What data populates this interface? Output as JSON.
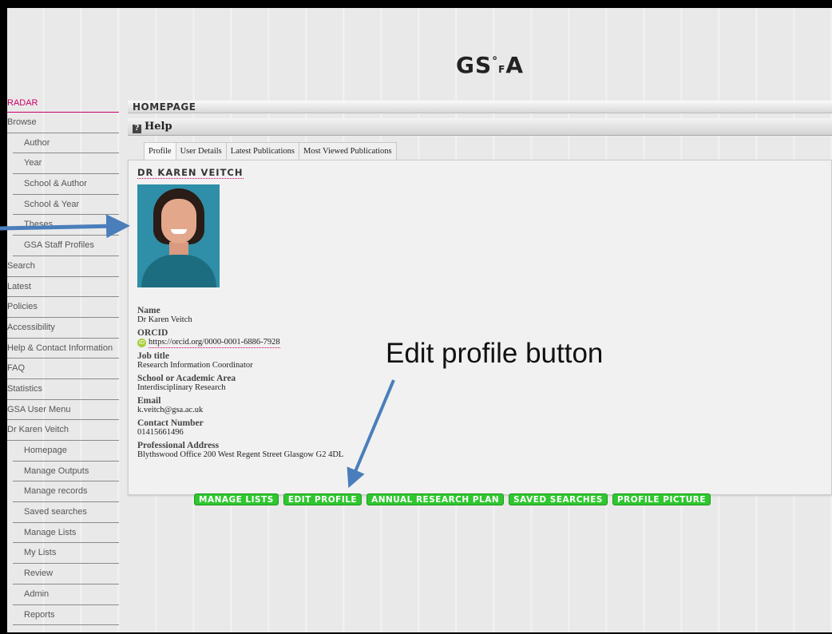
{
  "header": {
    "logo_text": "GSᵒⁱA"
  },
  "sidebar": {
    "items": [
      {
        "label": "RADAR",
        "kind": "radar"
      },
      {
        "label": "Browse",
        "kind": "top"
      },
      {
        "label": "Author",
        "kind": "sub"
      },
      {
        "label": "Year",
        "kind": "sub"
      },
      {
        "label": "School & Author",
        "kind": "sub"
      },
      {
        "label": "School & Year",
        "kind": "sub"
      },
      {
        "label": "Theses",
        "kind": "sub"
      },
      {
        "label": "GSA Staff Profiles",
        "kind": "sub"
      },
      {
        "label": "Search",
        "kind": "top"
      },
      {
        "label": "Latest",
        "kind": "top"
      },
      {
        "label": "Policies",
        "kind": "top"
      },
      {
        "label": "Accessibility",
        "kind": "top"
      },
      {
        "label": "Help & Contact Information",
        "kind": "top"
      },
      {
        "label": "FAQ",
        "kind": "top"
      },
      {
        "label": "Statistics",
        "kind": "top"
      },
      {
        "label": "GSA User Menu",
        "kind": "top"
      },
      {
        "label": "Dr Karen Veitch",
        "kind": "top"
      },
      {
        "label": "Homepage",
        "kind": "sub"
      },
      {
        "label": "Manage Outputs",
        "kind": "sub"
      },
      {
        "label": "Manage records",
        "kind": "sub"
      },
      {
        "label": "Saved searches",
        "kind": "sub"
      },
      {
        "label": "Manage Lists",
        "kind": "sub"
      },
      {
        "label": "My Lists",
        "kind": "sub"
      },
      {
        "label": "Review",
        "kind": "sub"
      },
      {
        "label": "Admin",
        "kind": "sub"
      },
      {
        "label": "Reports",
        "kind": "sub"
      }
    ]
  },
  "main": {
    "page_heading": "HOMEPAGE",
    "help_label": "Help",
    "tabs": [
      "Profile",
      "User Details",
      "Latest Publications",
      "Most Viewed Publications"
    ],
    "active_tab": "Profile",
    "profile": {
      "title": "DR KAREN VEITCH",
      "fields": [
        {
          "label": "Name",
          "value": "Dr Karen Veitch"
        },
        {
          "label": "ORCID",
          "value": "https://orcid.org/0000-0001-6886-7928",
          "icon": "orcid-icon"
        },
        {
          "label": "Job title",
          "value": "Research Information Coordinator"
        },
        {
          "label": "School or Academic Area",
          "value": "Interdisciplinary Research"
        },
        {
          "label": "Email",
          "value": "k.veitch@gsa.ac.uk"
        },
        {
          "label": "Contact Number",
          "value": "01415661496"
        },
        {
          "label": "Professional Address",
          "value": "Blythswood Office 200 West Regent Street Glasgow G2 4DL"
        }
      ]
    },
    "buttons": [
      "MANAGE LISTS",
      "EDIT PROFILE",
      "ANNUAL RESEARCH PLAN",
      "SAVED SEARCHES",
      "PROFILE PICTURE"
    ]
  },
  "annotation": {
    "text": "Edit profile button",
    "arrow_color": "#4a7ebb"
  },
  "colors": {
    "accent_pink": "#cc0066",
    "button_green": "#2ec72e",
    "background": "#e9e9e9"
  }
}
